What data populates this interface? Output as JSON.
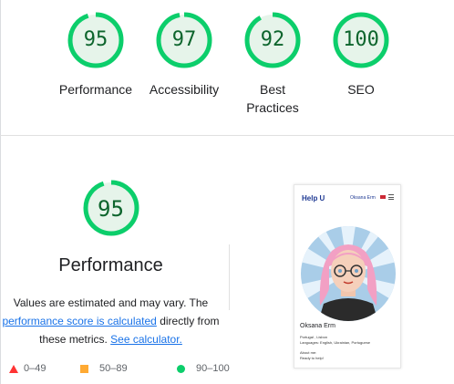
{
  "categories": [
    {
      "label": "Performance",
      "score": 95
    },
    {
      "label": "Accessibility",
      "score": 97
    },
    {
      "label": "Best Practices",
      "score": 92
    },
    {
      "label": "SEO",
      "score": 100
    }
  ],
  "performance": {
    "score": 95,
    "title": "Performance",
    "desc_line1": "Values are estimated and may vary. The",
    "link1": "performance score is calculated",
    "desc_mid": " directly from",
    "desc_line3_start": "these metrics. ",
    "link2": "See calculator."
  },
  "legend": [
    {
      "range": "0–49",
      "color": "#ff3333"
    },
    {
      "range": "50–89",
      "color": "#ffaa33"
    },
    {
      "range": "90–100",
      "color": "#0cce6b"
    }
  ],
  "colors": {
    "pass_ring": "#0cce6b",
    "pass_fill": "#e6f4ea",
    "pass_text": "#0d652d",
    "link": "#1a73e8"
  },
  "thumbnail": {
    "logo": "Help U",
    "user": "Oksana Erm",
    "name": "Oksana Erm",
    "location": "Portugal , Lisbon",
    "languages": "Languages: English, Ukrainian, Portuguese",
    "about_label": "About me:",
    "about_text": "Ready to help!"
  }
}
